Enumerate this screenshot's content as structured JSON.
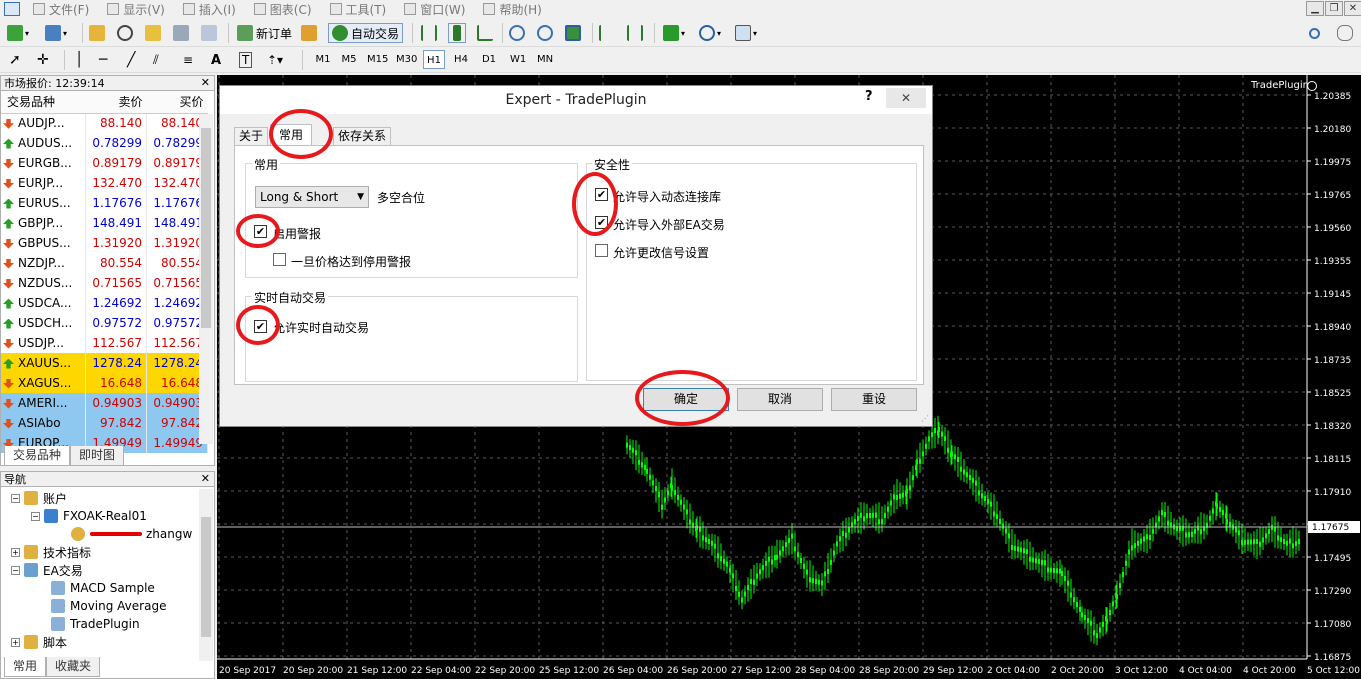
{
  "menu": {
    "items": [
      "文件(F)",
      "显示(V)",
      "插入(I)",
      "图表(C)",
      "工具(T)",
      "窗口(W)",
      "帮助(H)"
    ]
  },
  "toolbar": {
    "new_order": "新订单",
    "auto_trading": "自动交易",
    "timeframes": [
      "M1",
      "M5",
      "M15",
      "M30",
      "H1",
      "H4",
      "D1",
      "W1",
      "MN"
    ],
    "active_timeframe": "H1"
  },
  "market_watch": {
    "title": "市场报价: 12:39:14",
    "col_symbol": "交易品种",
    "col_bid": "卖价",
    "col_ask": "买价",
    "rows": [
      {
        "symbol": "AUDJP...",
        "bid": "88.140",
        "ask": "88.140",
        "dir": "down",
        "color": "#d00000",
        "bg": "#ffffff"
      },
      {
        "symbol": "AUDUS...",
        "bid": "0.78299",
        "ask": "0.78299",
        "dir": "up",
        "color": "#0000cc",
        "bg": "#ffffff"
      },
      {
        "symbol": "EURGB...",
        "bid": "0.89179",
        "ask": "0.89179",
        "dir": "down",
        "color": "#d00000",
        "bg": "#ffffff"
      },
      {
        "symbol": "EURJP...",
        "bid": "132.470",
        "ask": "132.470",
        "dir": "down",
        "color": "#d00000",
        "bg": "#ffffff"
      },
      {
        "symbol": "EURUS...",
        "bid": "1.17676",
        "ask": "1.17676",
        "dir": "up",
        "color": "#0000cc",
        "bg": "#ffffff"
      },
      {
        "symbol": "GBPJP...",
        "bid": "148.491",
        "ask": "148.491",
        "dir": "up",
        "color": "#0000cc",
        "bg": "#ffffff"
      },
      {
        "symbol": "GBPUS...",
        "bid": "1.31920",
        "ask": "1.31920",
        "dir": "down",
        "color": "#d00000",
        "bg": "#ffffff"
      },
      {
        "symbol": "NZDJP...",
        "bid": "80.554",
        "ask": "80.554",
        "dir": "down",
        "color": "#d00000",
        "bg": "#ffffff"
      },
      {
        "symbol": "NZDUS...",
        "bid": "0.71565",
        "ask": "0.71565",
        "dir": "down",
        "color": "#d00000",
        "bg": "#ffffff"
      },
      {
        "symbol": "USDCA...",
        "bid": "1.24692",
        "ask": "1.24692",
        "dir": "up",
        "color": "#0000cc",
        "bg": "#ffffff"
      },
      {
        "symbol": "USDCH...",
        "bid": "0.97572",
        "ask": "0.97572",
        "dir": "up",
        "color": "#0000cc",
        "bg": "#ffffff"
      },
      {
        "symbol": "USDJP...",
        "bid": "112.567",
        "ask": "112.567",
        "dir": "down",
        "color": "#d00000",
        "bg": "#ffffff"
      },
      {
        "symbol": "XAUUS...",
        "bid": "1278.24",
        "ask": "1278.24",
        "dir": "up",
        "color": "#0000cc",
        "bg": "#ffd700"
      },
      {
        "symbol": "XAGUS...",
        "bid": "16.648",
        "ask": "16.648",
        "dir": "down",
        "color": "#d00000",
        "bg": "#ffd700"
      },
      {
        "symbol": "AMERI...",
        "bid": "0.94903",
        "ask": "0.94903",
        "dir": "down",
        "color": "#d00000",
        "bg": "#8ec8f0"
      },
      {
        "symbol": "ASIAbo",
        "bid": "97.842",
        "ask": "97.842",
        "dir": "down",
        "color": "#d00000",
        "bg": "#8ec8f0"
      },
      {
        "symbol": "EUROP...",
        "bid": "1.49949",
        "ask": "1.49949",
        "dir": "down",
        "color": "#d00000",
        "bg": "#8ec8f0"
      }
    ],
    "tabs": [
      "交易品种",
      "即时图"
    ]
  },
  "navigator": {
    "title": "导航",
    "accounts": "账户",
    "account_name": "FXOAK-Real01",
    "account_user": "zhangw",
    "indicators": "技术指标",
    "ea": "EA交易",
    "ea_items": [
      "MACD Sample",
      "Moving Average",
      "TradePlugin"
    ],
    "scripts": "脚本",
    "tabs": [
      "常用",
      "收藏夹"
    ]
  },
  "chart": {
    "plugin_label": "TradePlugin",
    "prices": [
      "1.20385",
      "1.20180",
      "1.19975",
      "1.19765",
      "1.19560",
      "1.19355",
      "1.19145",
      "1.18940",
      "1.18735",
      "1.18525",
      "1.18320",
      "1.18115",
      "1.17910",
      "1.17705",
      "1.17495",
      "1.17290",
      "1.17080",
      "1.16875"
    ],
    "current_price": "1.17675",
    "dates": [
      "20 Sep 2017",
      "20 Sep 20:00",
      "21 Sep 12:00",
      "22 Sep 04:00",
      "22 Sep 20:00",
      "25 Sep 12:00",
      "26 Sep 04:00",
      "26 Sep 20:00",
      "27 Sep 12:00",
      "28 Sep 04:00",
      "28 Sep 20:00",
      "29 Sep 12:00",
      "2 Oct 04:00",
      "2 Oct 20:00",
      "3 Oct 12:00",
      "4 Oct 04:00",
      "4 Oct 20:00",
      "5 Oct 12:00"
    ],
    "colors": {
      "background": "#000000",
      "candles": "#00ff00",
      "grid": "#5a5a5a"
    }
  },
  "dialog": {
    "title": "Expert - TradePlugin",
    "help": "?",
    "close": "✕",
    "tabs": [
      "关于",
      "常用",
      "依存关系"
    ],
    "active_tab": "常用",
    "common_group": "常用",
    "position_select": "Long & Short",
    "position_label": "多空合位",
    "enable_alerts": "启用警报",
    "enable_alerts_checked": true,
    "disable_alert_label": "一旦价格达到停用警报",
    "disable_alert_checked": false,
    "live_group": "实时自动交易",
    "allow_live": "允许实时自动交易",
    "allow_live_checked": true,
    "security_group": "安全性",
    "allow_dll": "允许导入动态连接库",
    "allow_dll_checked": true,
    "allow_ea_import": "允许导入外部EA交易",
    "allow_ea_import_checked": true,
    "allow_signal": "允许更改信号设置",
    "allow_signal_checked": false,
    "ok": "确定",
    "cancel": "取消",
    "reset": "重设"
  }
}
